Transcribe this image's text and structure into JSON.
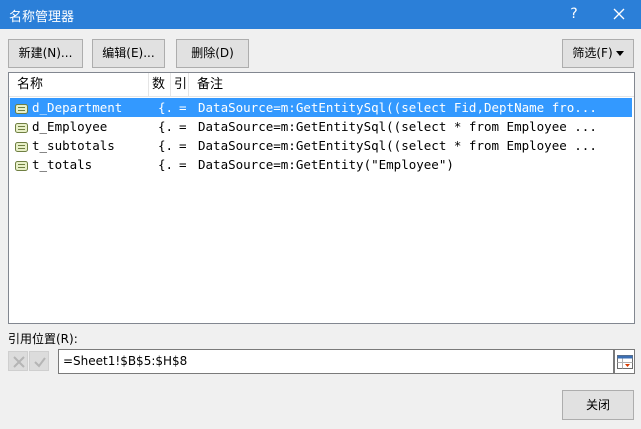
{
  "window": {
    "title": "名称管理器",
    "help_label": "?",
    "accent_color": "#2b7fd8"
  },
  "toolbar": {
    "new_label": "新建(N)...",
    "edit_label": "编辑(E)...",
    "delete_label": "删除(D)",
    "filter_label": "筛选(F)"
  },
  "list": {
    "columns": {
      "name": "名称",
      "value": "数",
      "ref": "引",
      "comment": "备注"
    },
    "rows": [
      {
        "name": "d_Department",
        "value": "{.",
        "ref": "=",
        "comment": "DataSource=m:GetEntitySql((select Fid,DeptName fro...",
        "selected": true
      },
      {
        "name": "d_Employee",
        "value": "{.",
        "ref": "=",
        "comment": "DataSource=m:GetEntitySql((select * from Employee ...",
        "selected": false
      },
      {
        "name": "t_subtotals",
        "value": "{.",
        "ref": "=",
        "comment": "DataSource=m:GetEntitySql((select * from Employee ...",
        "selected": false
      },
      {
        "name": "t_totals",
        "value": "{.",
        "ref": "=",
        "comment": "DataSource=m:GetEntity(\"Employee\")",
        "selected": false
      }
    ],
    "selection_color": "#3399ff"
  },
  "reference": {
    "label": "引用位置(R):",
    "value": "=Sheet1!$B$5:$H$8"
  },
  "footer": {
    "close_label": "关闭"
  }
}
